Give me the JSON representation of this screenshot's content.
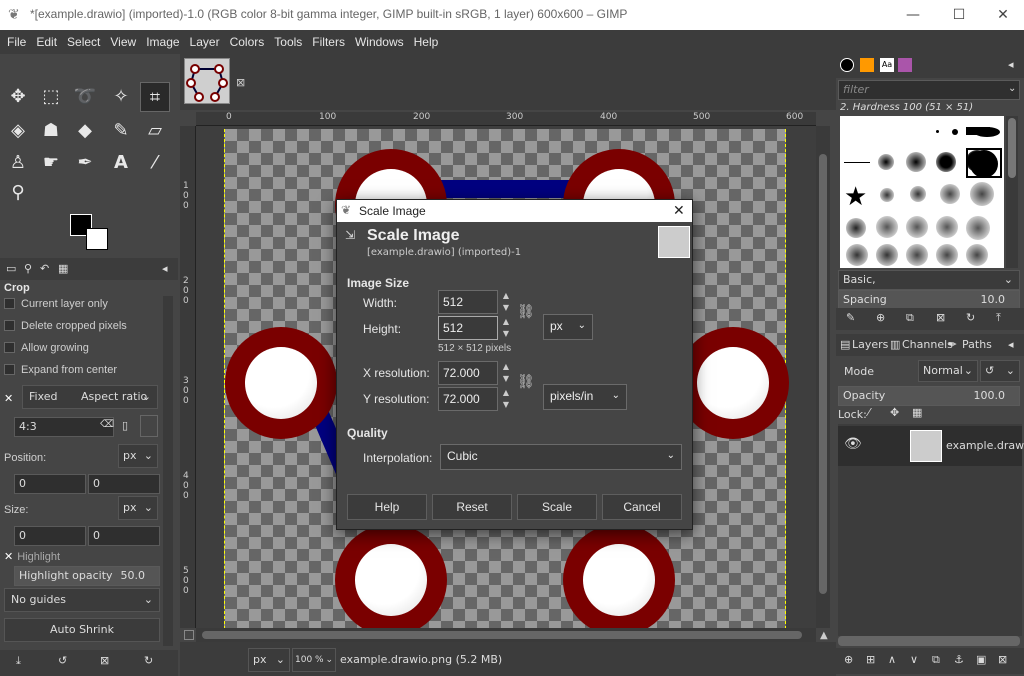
{
  "window": {
    "title": "*[example.drawio] (imported)-1.0 (RGB color 8-bit gamma integer, GIMP built-in sRGB, 1 layer) 600x600 – GIMP",
    "minimize": "—",
    "maximize": "☐",
    "close": "✕"
  },
  "menu": [
    "File",
    "Edit",
    "Select",
    "View",
    "Image",
    "Layer",
    "Colors",
    "Tools",
    "Filters",
    "Windows",
    "Help"
  ],
  "toolbox": {
    "crop": {
      "title": "Crop",
      "current_layer_only": "Current layer only",
      "delete_cropped": "Delete cropped pixels",
      "allow_growing": "Allow growing",
      "expand_center": "Expand from center",
      "fixed": "Fixed",
      "fixed_mode": "Aspect ratio",
      "ratio": "4:3",
      "position_label": "Position:",
      "position_unit": "px",
      "pos_x": "0",
      "pos_y": "0",
      "size_label": "Size:",
      "size_unit": "px",
      "size_w": "0",
      "size_h": "0",
      "highlight": "Highlight",
      "highlight_opacity_label": "Highlight opacity",
      "highlight_opacity": "50.0",
      "guides": "No guides",
      "auto_shrink": "Auto Shrink"
    }
  },
  "ruler": {
    "h_ticks": [
      "0",
      "100",
      "200",
      "300",
      "400",
      "500",
      "600"
    ],
    "v_ticks": [
      "1 0 0",
      "2 0 0",
      "3 0 0",
      "4 0 0",
      "5 0 0"
    ]
  },
  "statusbar": {
    "unit": "px",
    "zoom": "100 %",
    "file": "example.drawio.png (5.2 MB)"
  },
  "brushes": {
    "filter_placeholder": "filter",
    "current": "2. Hardness 100 (51 × 51)",
    "preset": "Basic,",
    "spacing_label": "Spacing",
    "spacing": "10.0"
  },
  "layers": {
    "tabs": [
      "Layers",
      "Channels",
      "Paths"
    ],
    "mode_label": "Mode",
    "mode": "Normal",
    "opacity_label": "Opacity",
    "opacity": "100.0",
    "lock_label": "Lock:",
    "layer_name": "example.drawio"
  },
  "dialog": {
    "title": "Scale Image",
    "header": "Scale Image",
    "subheader": "[example.drawio] (imported)-1",
    "image_size": "Image Size",
    "width_label": "Width:",
    "width": "512",
    "height_label": "Height:",
    "height": "512",
    "size_unit": "px",
    "pixels_note": "512 × 512 pixels",
    "xres_label": "X resolution:",
    "xres": "72.000",
    "yres_label": "Y resolution:",
    "yres": "72.000",
    "res_unit": "pixels/in",
    "quality": "Quality",
    "interp_label": "Interpolation:",
    "interp": "Cubic",
    "help": "Help",
    "reset": "Reset",
    "scale": "Scale",
    "cancel": "Cancel"
  }
}
